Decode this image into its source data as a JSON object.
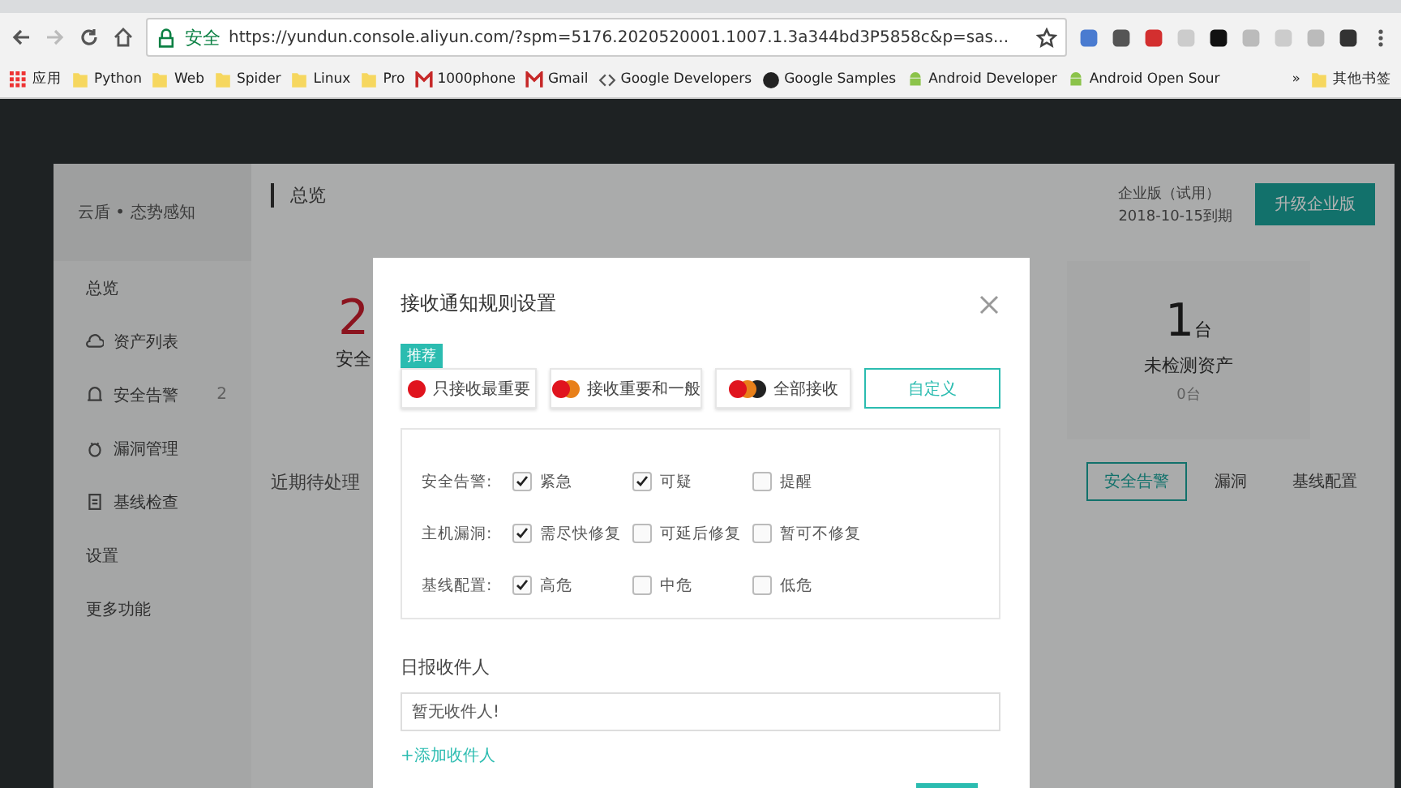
{
  "browser": {
    "secure_label": "安全",
    "url": "https://yundun.console.aliyun.com/?spm=5176.2020520001.1007.1.3a344bd3P5858c&p=sas...",
    "bookmarks": [
      {
        "kind": "apps",
        "label": "应用"
      },
      {
        "kind": "folder",
        "label": "Python"
      },
      {
        "kind": "folder",
        "label": "Web"
      },
      {
        "kind": "folder",
        "label": "Spider"
      },
      {
        "kind": "folder",
        "label": "Linux"
      },
      {
        "kind": "folder",
        "label": "Pro"
      },
      {
        "kind": "mail",
        "label": "1000phone"
      },
      {
        "kind": "mail",
        "label": "Gmail"
      },
      {
        "kind": "code",
        "label": "Google Developers"
      },
      {
        "kind": "github",
        "label": "Google Samples"
      },
      {
        "kind": "android",
        "label": "Android Developer"
      },
      {
        "kind": "android",
        "label": "Android Open Sour"
      }
    ],
    "more": "»",
    "other_bookmarks": "其他书签"
  },
  "console": {
    "sidebar": {
      "title": "云盾 • 态势感知",
      "items": [
        {
          "label": "总览",
          "kind": "plain"
        },
        {
          "label": "资产列表",
          "kind": "cloud"
        },
        {
          "label": "安全告警",
          "kind": "bell",
          "badge": "2"
        },
        {
          "label": "漏洞管理",
          "kind": "bug"
        },
        {
          "label": "基线检查",
          "kind": "doc"
        },
        {
          "label": "设置",
          "kind": "plain"
        },
        {
          "label": "更多功能",
          "kind": "plain"
        }
      ]
    },
    "header": {
      "title": "总览",
      "edition": "企业版（试用）",
      "expiry": "2018-10-15到期",
      "upgrade": "升级企业版"
    },
    "stat_left": {
      "value": "2",
      "label": "安全"
    },
    "stat_right": {
      "value": "1",
      "unit": "台",
      "label": "未检测资产",
      "sub": "0台"
    },
    "section_title": "近期待处理",
    "tabs": [
      {
        "label": "安全告警",
        "selected": true
      },
      {
        "label": "漏洞",
        "selected": false
      },
      {
        "label": "基线配置",
        "selected": false
      }
    ]
  },
  "modal": {
    "title": "接收通知规则设置",
    "recommend": "推荐",
    "presets": [
      {
        "label": "只接收最重要",
        "kind": "one",
        "selected": false
      },
      {
        "label": "接收重要和一般",
        "kind": "two",
        "selected": false
      },
      {
        "label": "全部接收",
        "kind": "three",
        "selected": false
      },
      {
        "label": "自定义",
        "kind": "custom",
        "selected": true
      }
    ],
    "rules": [
      {
        "label": "安全告警:",
        "options": [
          {
            "label": "紧急",
            "checked": true
          },
          {
            "label": "可疑",
            "checked": true
          },
          {
            "label": "提醒",
            "checked": false
          }
        ]
      },
      {
        "label": "主机漏洞:",
        "options": [
          {
            "label": "需尽快修复",
            "checked": true
          },
          {
            "label": "可延后修复",
            "checked": false
          },
          {
            "label": "暂可不修复",
            "checked": false
          }
        ]
      },
      {
        "label": "基线配置:",
        "options": [
          {
            "label": "高危",
            "checked": true
          },
          {
            "label": "中危",
            "checked": false
          },
          {
            "label": "低危",
            "checked": false
          }
        ]
      }
    ],
    "recipients": {
      "label": "日报收件人",
      "placeholder": "暂无收件人!",
      "add": "+添加收件人"
    }
  }
}
